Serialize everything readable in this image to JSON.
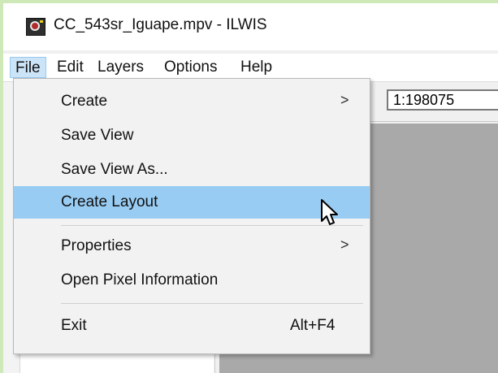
{
  "window": {
    "title": "CC_543sr_Iguape.mpv - ILWIS"
  },
  "menubar": {
    "items": [
      "File",
      "Edit",
      "Layers",
      "Options",
      "Help"
    ]
  },
  "toolbar": {
    "scale_value": "1:198075"
  },
  "file_menu": {
    "items": [
      {
        "label": "Create",
        "submenu": true
      },
      {
        "label": "Save View"
      },
      {
        "label": "Save View As..."
      },
      {
        "label": "Create Layout",
        "highlighted": true
      },
      {
        "label": "Properties",
        "submenu": true
      },
      {
        "label": "Open Pixel Information"
      },
      {
        "label": "Exit",
        "shortcut": "Alt+F4"
      }
    ],
    "submenu_arrow": ">"
  },
  "colors": {
    "highlight": "#99ccf3",
    "map_background": "#a9a9a9",
    "desktop": "#cfe8b8"
  }
}
